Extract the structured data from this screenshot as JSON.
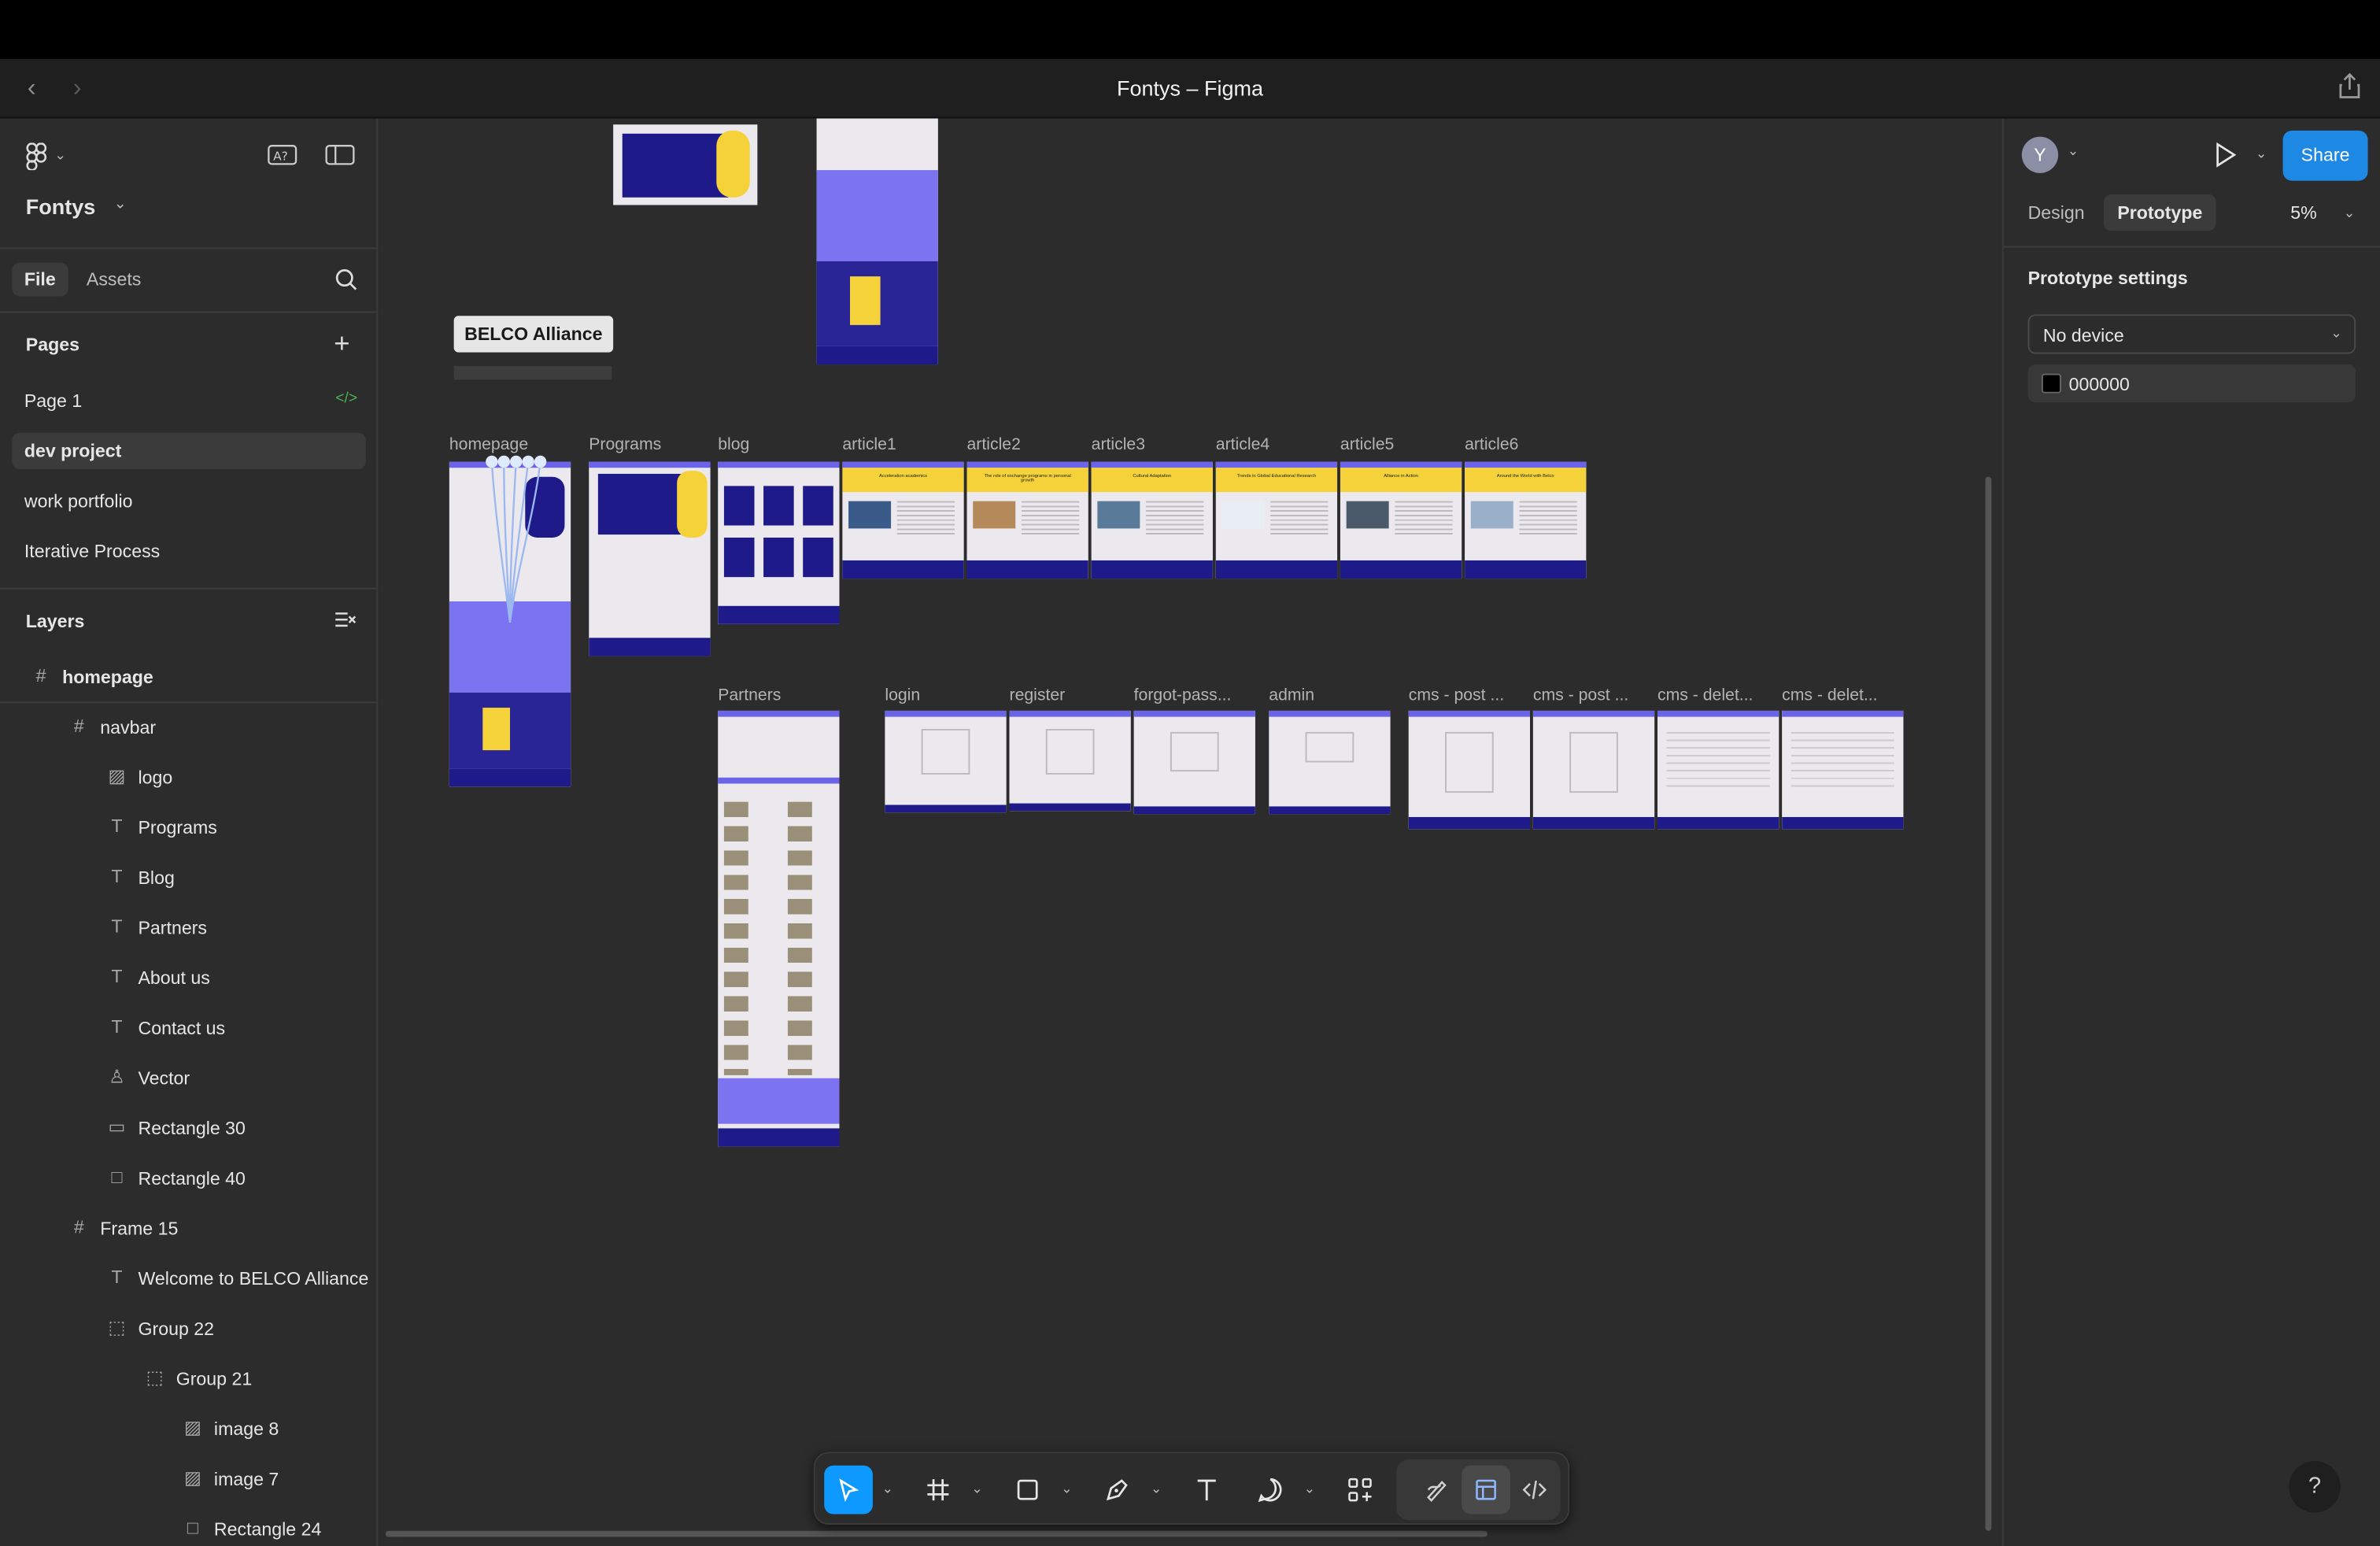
{
  "window": {
    "title": "Fontys – Figma"
  },
  "sidebar": {
    "project_name": "Fontys",
    "tabs": {
      "file": "File",
      "assets": "Assets"
    },
    "pages_header": "Pages",
    "pages": [
      "Page 1",
      "dev project",
      "work portfolio",
      "Iterative Process"
    ],
    "active_page": "dev project",
    "layers_header": "Layers",
    "layers": [
      {
        "name": "homepage",
        "icon": "frame-icon",
        "indent": 0
      },
      {
        "name": "navbar",
        "icon": "frame-icon",
        "indent": 1
      },
      {
        "name": "logo",
        "icon": "image-icon",
        "indent": 2
      },
      {
        "name": "Programs",
        "icon": "text-icon",
        "indent": 2
      },
      {
        "name": "Blog",
        "icon": "text-icon",
        "indent": 2
      },
      {
        "name": "Partners",
        "icon": "text-icon",
        "indent": 2
      },
      {
        "name": "About us",
        "icon": "text-icon",
        "indent": 2
      },
      {
        "name": "Contact us",
        "icon": "text-icon",
        "indent": 2
      },
      {
        "name": "Vector",
        "icon": "vector-icon",
        "indent": 2
      },
      {
        "name": "Rectangle 30",
        "icon": "rectangle-icon",
        "indent": 2
      },
      {
        "name": "Rectangle 40",
        "icon": "square-icon",
        "indent": 2
      },
      {
        "name": "Frame 15",
        "icon": "frame-icon",
        "indent": 1
      },
      {
        "name": "Welcome to BELCO Alliance",
        "icon": "text-icon",
        "indent": 2
      },
      {
        "name": "Group 22",
        "icon": "group-icon",
        "indent": 2
      },
      {
        "name": "Group 21",
        "icon": "group-icon",
        "indent": 3
      },
      {
        "name": "image 8",
        "icon": "image-icon",
        "indent": 4
      },
      {
        "name": "image 7",
        "icon": "image-icon",
        "indent": 4
      },
      {
        "name": "Rectangle 24",
        "icon": "square-icon",
        "indent": 4
      }
    ]
  },
  "canvas": {
    "selected_label": "BELCO Alliance",
    "frames_row1": [
      "homepage",
      "Programs",
      "blog",
      "article1",
      "article2",
      "article3",
      "article4",
      "article5",
      "article6"
    ],
    "frames_row2": [
      "Partners",
      "login",
      "register",
      "forgot-pass...",
      "admin",
      "cms - post ...",
      "cms - post ...",
      "cms - delet...",
      "cms - delet..."
    ],
    "article_titles": [
      "Acceleration academics",
      "The role of exchange programs in personal growth",
      "Cultural Adaptation",
      "Trends in Global Educational Research",
      "Alliance in Action",
      "Around the World with Belco"
    ]
  },
  "right_panel": {
    "avatar_initial": "Y",
    "share_label": "Share",
    "tabs": {
      "design": "Design",
      "prototype": "Prototype"
    },
    "zoom": "5%",
    "section_title": "Prototype settings",
    "device": "No device",
    "background_color": "000000"
  },
  "colors": {
    "accent": "#0d99ff",
    "share": "#1e88e5",
    "frame_purple": "#6b63e8",
    "frame_navy": "#1e1a8a",
    "frame_yellow": "#f5d13a"
  }
}
